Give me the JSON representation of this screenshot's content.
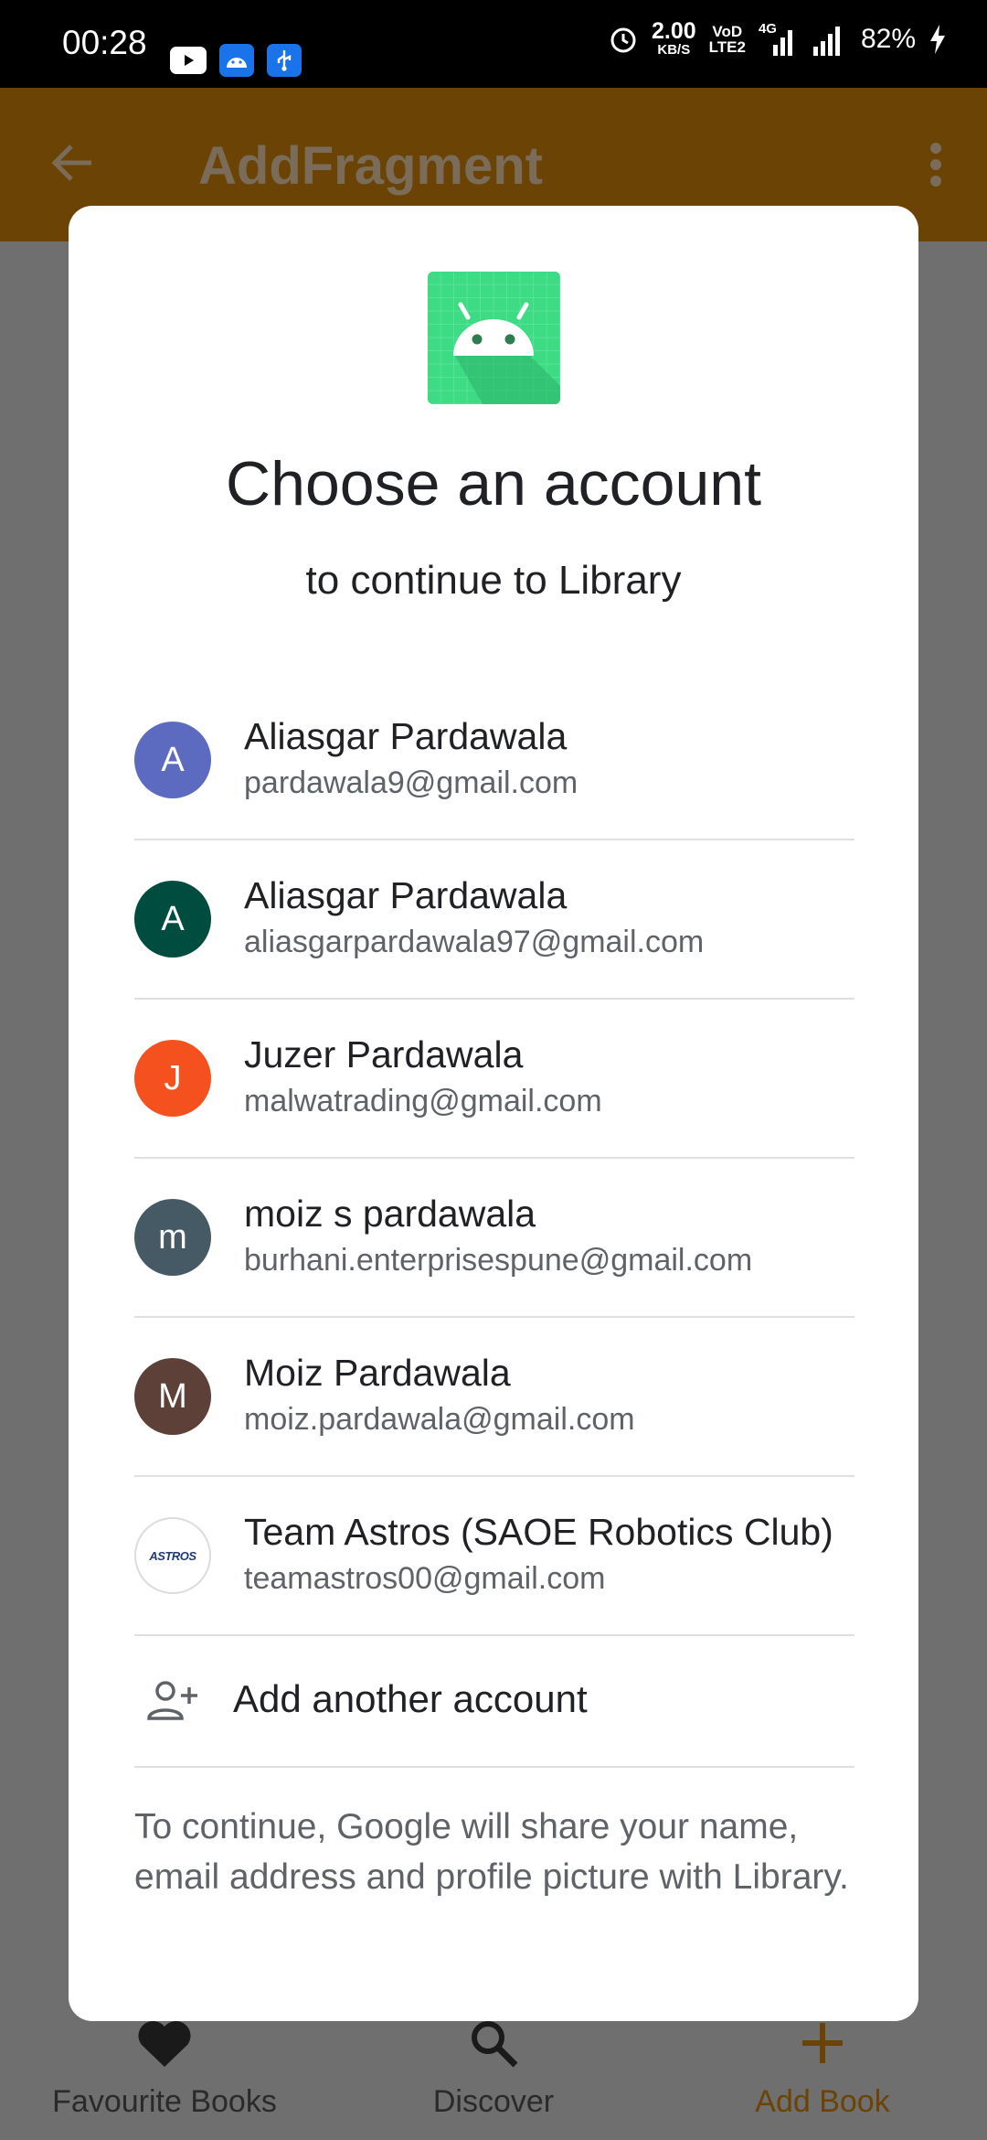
{
  "status_bar": {
    "time": "00:28",
    "network_speed": "2.00",
    "network_unit": "KB/S",
    "volte_top": "VoD",
    "volte_bottom": "LTE2",
    "network_type": "4G",
    "battery": "82%"
  },
  "app_bar": {
    "title": "AddFragment"
  },
  "dialog": {
    "title": "Choose an account",
    "subtitle": "to continue to Library",
    "accounts": [
      {
        "initial": "A",
        "name": "Aliasgar Pardawala",
        "email": "pardawala9@gmail.com",
        "color": "#5c6bc0"
      },
      {
        "initial": "A",
        "name": "Aliasgar Pardawala",
        "email": "aliasgarpardawala97@gmail.com",
        "color": "#004d40"
      },
      {
        "initial": "J",
        "name": "Juzer Pardawala",
        "email": "malwatrading@gmail.com",
        "color": "#f4511e"
      },
      {
        "initial": "m",
        "name": "moiz s pardawala",
        "email": "burhani.enterprisespune@gmail.com",
        "color": "#455a64"
      },
      {
        "initial": "M",
        "name": "Moiz Pardawala",
        "email": "moiz.pardawala@gmail.com",
        "color": "#5d4037"
      },
      {
        "initial": "ASTROS",
        "name": "Team Astros (SAOE Robotics Club)",
        "email": "teamastros00@gmail.com",
        "color": "#ffffff"
      }
    ],
    "add_account_label": "Add another account",
    "disclaimer": "To continue, Google will share your name, email address and profile picture with Library."
  },
  "bottom_nav": {
    "items": [
      {
        "label": "Favourite Books",
        "icon": "heart-icon"
      },
      {
        "label": "Discover",
        "icon": "search-icon"
      },
      {
        "label": "Add Book",
        "icon": "plus-icon"
      }
    ],
    "active_color": "#6b4305"
  }
}
